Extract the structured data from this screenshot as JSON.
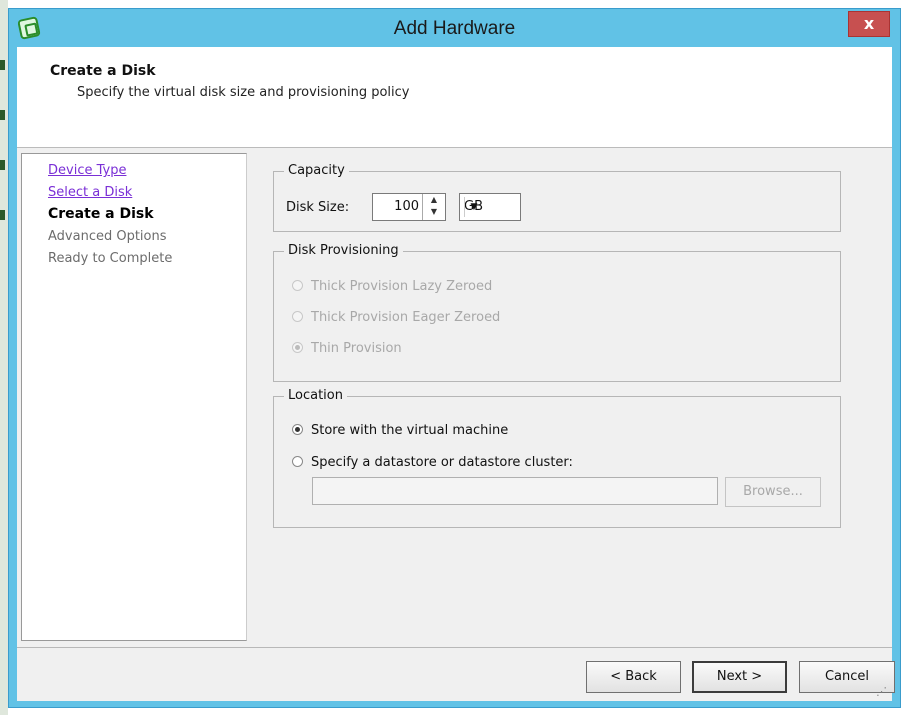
{
  "window": {
    "title": "Add Hardware",
    "close_label": "x"
  },
  "header": {
    "title": "Create a Disk",
    "subtitle": "Specify the virtual disk size and provisioning policy"
  },
  "nav": {
    "items": [
      {
        "label": "Device Type",
        "state": "visited-link"
      },
      {
        "label": "Select a Disk",
        "state": "visited-link"
      },
      {
        "label": "Create a Disk",
        "state": "current"
      },
      {
        "label": "Advanced Options",
        "state": "pending"
      },
      {
        "label": "Ready to Complete",
        "state": "pending"
      }
    ]
  },
  "capacity": {
    "legend": "Capacity",
    "disk_size_label": "Disk Size:",
    "disk_size_value": "100",
    "unit": "GB"
  },
  "provisioning": {
    "legend": "Disk Provisioning",
    "options": [
      {
        "label": "Thick Provision Lazy Zeroed",
        "checked": false,
        "enabled": false
      },
      {
        "label": "Thick Provision Eager Zeroed",
        "checked": false,
        "enabled": false
      },
      {
        "label": "Thin Provision",
        "checked": true,
        "enabled": false
      }
    ]
  },
  "location": {
    "legend": "Location",
    "options": [
      {
        "label": "Store with the virtual machine",
        "checked": true
      },
      {
        "label": "Specify a datastore or datastore cluster:",
        "checked": false
      }
    ],
    "datastore_value": "",
    "browse_label": "Browse..."
  },
  "footer": {
    "back_label": "< Back",
    "next_label": "Next >",
    "cancel_label": "Cancel"
  },
  "colors": {
    "titlebar": "#61c2e6",
    "close_button": "#c75050",
    "visited_link": "#7a2fd6"
  }
}
